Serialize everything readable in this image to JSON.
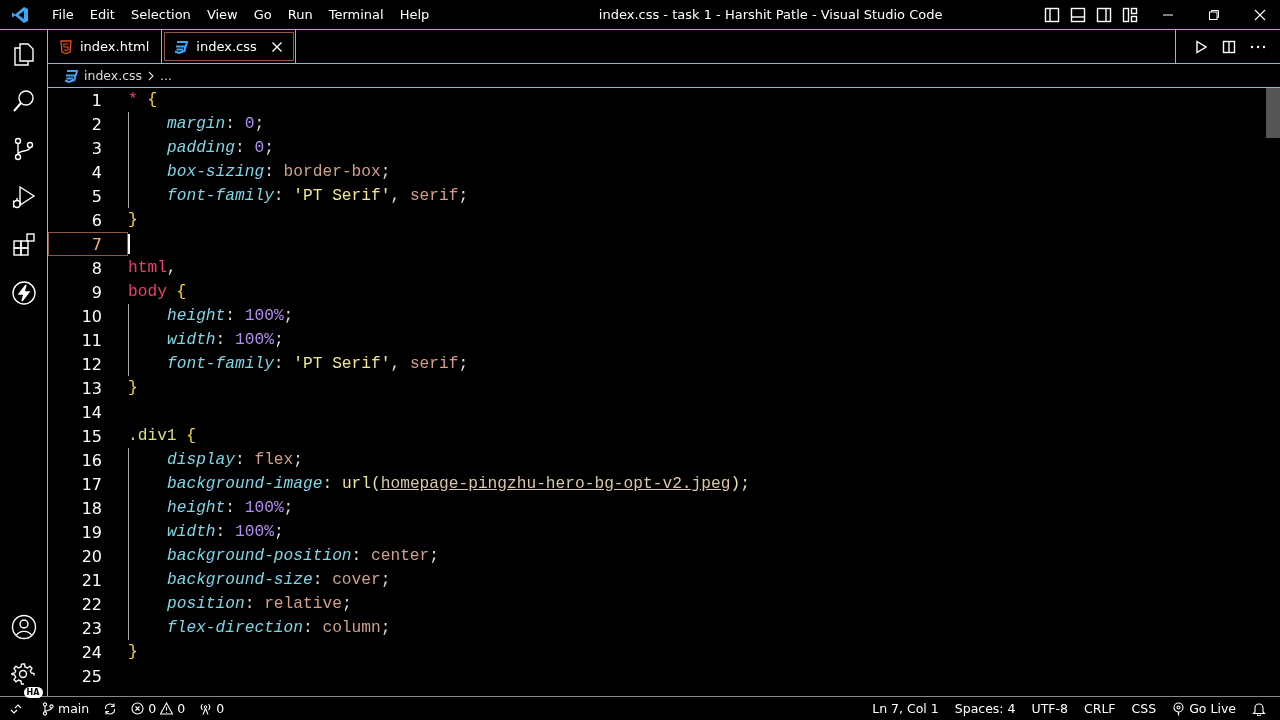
{
  "menu": [
    "File",
    "Edit",
    "Selection",
    "View",
    "Go",
    "Run",
    "Terminal",
    "Help"
  ],
  "window": {
    "title": "index.css - task 1 - Harshit Patle - Visual Studio Code"
  },
  "tabs": [
    {
      "label": "index.html",
      "kind": "html",
      "selected": false
    },
    {
      "label": "index.css",
      "kind": "css",
      "selected": true
    }
  ],
  "breadcrumb": {
    "file": "index.css",
    "rest": "..."
  },
  "lines": [
    {
      "number": "1",
      "current": false,
      "guide": false,
      "tokens": [
        {
          "kind": "selector",
          "text": "*"
        },
        {
          "kind": "brace",
          "text": " {"
        }
      ]
    },
    {
      "number": "2",
      "current": false,
      "guide": true,
      "tokens": [
        {
          "kind": "property",
          "text": "margin"
        },
        {
          "kind": "punct",
          "text": ": "
        },
        {
          "kind": "number",
          "text": "0"
        },
        {
          "kind": "punct",
          "text": ";"
        }
      ]
    },
    {
      "number": "3",
      "current": false,
      "guide": true,
      "tokens": [
        {
          "kind": "property",
          "text": "padding"
        },
        {
          "kind": "punct",
          "text": ": "
        },
        {
          "kind": "number",
          "text": "0"
        },
        {
          "kind": "punct",
          "text": ";"
        }
      ]
    },
    {
      "number": "4",
      "current": false,
      "guide": true,
      "tokens": [
        {
          "kind": "property",
          "text": "box-sizing"
        },
        {
          "kind": "punct",
          "text": ": "
        },
        {
          "kind": "value",
          "text": "border-box"
        },
        {
          "kind": "punct",
          "text": ";"
        }
      ]
    },
    {
      "number": "5",
      "current": false,
      "guide": true,
      "tokens": [
        {
          "kind": "property",
          "text": "font-family"
        },
        {
          "kind": "punct",
          "text": ": "
        },
        {
          "kind": "string",
          "text": "'PT Serif'"
        },
        {
          "kind": "punct",
          "text": ", "
        },
        {
          "kind": "value",
          "text": "serif"
        },
        {
          "kind": "punct",
          "text": ";"
        }
      ]
    },
    {
      "number": "6",
      "current": false,
      "guide": false,
      "tokens": [
        {
          "kind": "brace",
          "text": "}"
        }
      ]
    },
    {
      "number": "7",
      "current": true,
      "guide": false
    },
    {
      "number": "8",
      "current": false,
      "guide": false,
      "tokens": [
        {
          "kind": "selector",
          "text": "html"
        },
        {
          "kind": "punct",
          "text": ","
        }
      ]
    },
    {
      "number": "9",
      "current": false,
      "guide": false,
      "tokens": [
        {
          "kind": "selector",
          "text": "body"
        },
        {
          "kind": "brace",
          "text": " {"
        }
      ]
    },
    {
      "number": "10",
      "current": false,
      "guide": true,
      "tokens": [
        {
          "kind": "property",
          "text": "height"
        },
        {
          "kind": "punct",
          "text": ": "
        },
        {
          "kind": "number",
          "text": "100%"
        },
        {
          "kind": "punct",
          "text": ";"
        }
      ]
    },
    {
      "number": "11",
      "current": false,
      "guide": true,
      "tokens": [
        {
          "kind": "property",
          "text": "width"
        },
        {
          "kind": "punct",
          "text": ": "
        },
        {
          "kind": "number",
          "text": "100%"
        },
        {
          "kind": "punct",
          "text": ";"
        }
      ]
    },
    {
      "number": "12",
      "current": false,
      "guide": true,
      "tokens": [
        {
          "kind": "property",
          "text": "font-family"
        },
        {
          "kind": "punct",
          "text": ": "
        },
        {
          "kind": "string",
          "text": "'PT Serif'"
        },
        {
          "kind": "punct",
          "text": ", "
        },
        {
          "kind": "value",
          "text": "serif"
        },
        {
          "kind": "punct",
          "text": ";"
        }
      ]
    },
    {
      "number": "13",
      "current": false,
      "guide": false,
      "tokens": [
        {
          "kind": "brace",
          "text": "}"
        }
      ]
    },
    {
      "number": "14",
      "current": false,
      "guide": false
    },
    {
      "number": "15",
      "current": false,
      "guide": false,
      "tokens": [
        {
          "kind": "class",
          "text": ".div1"
        },
        {
          "kind": "brace",
          "text": " {"
        }
      ]
    },
    {
      "number": "16",
      "current": false,
      "guide": true,
      "tokens": [
        {
          "kind": "property",
          "text": "display"
        },
        {
          "kind": "punct",
          "text": ": "
        },
        {
          "kind": "value",
          "text": "flex"
        },
        {
          "kind": "punct",
          "text": ";"
        }
      ]
    },
    {
      "number": "17",
      "current": false,
      "guide": true,
      "tokens": [
        {
          "kind": "property",
          "text": "background-image"
        },
        {
          "kind": "punct",
          "text": ": "
        },
        {
          "kind": "function",
          "text": "url("
        },
        {
          "kind": "url",
          "text": "homepage-pingzhu-hero-bg-opt-v2.jpeg"
        },
        {
          "kind": "function",
          "text": ")"
        },
        {
          "kind": "punct",
          "text": ";"
        }
      ]
    },
    {
      "number": "18",
      "current": false,
      "guide": true,
      "tokens": [
        {
          "kind": "property",
          "text": "height"
        },
        {
          "kind": "punct",
          "text": ": "
        },
        {
          "kind": "number",
          "text": "100%"
        },
        {
          "kind": "punct",
          "text": ";"
        }
      ]
    },
    {
      "number": "19",
      "current": false,
      "guide": true,
      "tokens": [
        {
          "kind": "property",
          "text": "width"
        },
        {
          "kind": "punct",
          "text": ": "
        },
        {
          "kind": "number",
          "text": "100%"
        },
        {
          "kind": "punct",
          "text": ";"
        }
      ]
    },
    {
      "number": "20",
      "current": false,
      "guide": true,
      "tokens": [
        {
          "kind": "property",
          "text": "background-position"
        },
        {
          "kind": "punct",
          "text": ": "
        },
        {
          "kind": "value",
          "text": "center"
        },
        {
          "kind": "punct",
          "text": ";"
        }
      ]
    },
    {
      "number": "21",
      "current": false,
      "guide": true,
      "tokens": [
        {
          "kind": "property",
          "text": "background-size"
        },
        {
          "kind": "punct",
          "text": ": "
        },
        {
          "kind": "value",
          "text": "cover"
        },
        {
          "kind": "punct",
          "text": ";"
        }
      ]
    },
    {
      "number": "22",
      "current": false,
      "guide": true,
      "tokens": [
        {
          "kind": "property",
          "text": "position"
        },
        {
          "kind": "punct",
          "text": ": "
        },
        {
          "kind": "value",
          "text": "relative"
        },
        {
          "kind": "punct",
          "text": ";"
        }
      ]
    },
    {
      "number": "23",
      "current": false,
      "guide": true,
      "tokens": [
        {
          "kind": "property",
          "text": "flex-direction"
        },
        {
          "kind": "punct",
          "text": ": "
        },
        {
          "kind": "value",
          "text": "column"
        },
        {
          "kind": "punct",
          "text": ";"
        }
      ]
    },
    {
      "number": "24",
      "current": false,
      "guide": false,
      "tokens": [
        {
          "kind": "brace",
          "text": "}"
        }
      ]
    },
    {
      "number": "25",
      "current": false,
      "guide": false
    }
  ],
  "status_bar": {
    "branch": "main",
    "errors": "0",
    "warnings": "0",
    "ports": "0",
    "right": [
      "Ln 7, Col 1",
      "Spaces: 4",
      "UTF-8",
      "CRLF",
      "CSS"
    ],
    "go_live": "Go Live"
  },
  "account_badge": "HA"
}
